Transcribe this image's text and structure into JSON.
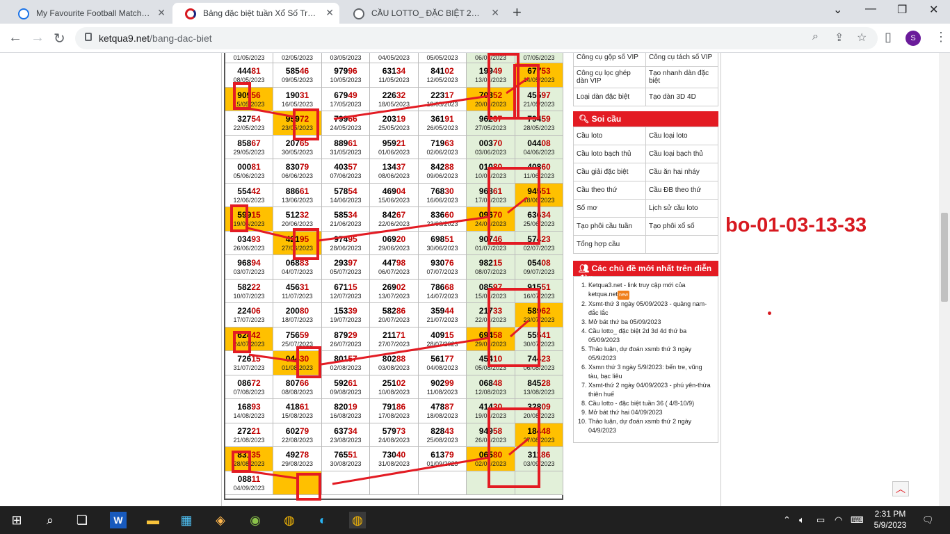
{
  "browser": {
    "tabs": [
      {
        "label": "My Favourite Football Matches, T",
        "active": false
      },
      {
        "label": "Bảng đặc biệt tuần Xổ Số Truyền",
        "active": true
      },
      {
        "label": "CẦU LOTTO_ ĐẶC BIỆT 2D 3D 4D",
        "active": false
      }
    ],
    "url_host": "ketqua9.net",
    "url_path": "/bang-dac-biet",
    "profile_initial": "S"
  },
  "table": {
    "header_dates": [
      "01/05/2023",
      "02/05/2023",
      "03/05/2023",
      "04/05/2023",
      "05/05/2023",
      "06/05/2023",
      "07/05/2023"
    ],
    "rows": [
      [
        {
          "n": "44481",
          "d": "08/05/2023"
        },
        {
          "n": "58546",
          "d": "09/05/2023"
        },
        {
          "n": "97996",
          "d": "10/05/2023"
        },
        {
          "n": "63134",
          "d": "11/05/2023"
        },
        {
          "n": "84102",
          "d": "12/05/2023"
        },
        {
          "n": "19949",
          "d": "13/05/2023"
        },
        {
          "n": "67753",
          "d": "14/05/2023",
          "y": true
        }
      ],
      [
        {
          "n": "90956",
          "d": "15/05/2023",
          "y": true
        },
        {
          "n": "19031",
          "d": "16/05/2023"
        },
        {
          "n": "67949",
          "d": "17/05/2023"
        },
        {
          "n": "22632",
          "d": "18/05/2023"
        },
        {
          "n": "22317",
          "d": "19/05/2023"
        },
        {
          "n": "70852",
          "d": "20/05/2023",
          "y": true
        },
        {
          "n": "45597",
          "d": "21/05/2023"
        }
      ],
      [
        {
          "n": "32754",
          "d": "22/05/2023"
        },
        {
          "n": "95972",
          "d": "23/05/2023",
          "y": true
        },
        {
          "n": "79966",
          "d": "24/05/2023"
        },
        {
          "n": "20319",
          "d": "25/05/2023"
        },
        {
          "n": "36191",
          "d": "26/05/2023"
        },
        {
          "n": "96237",
          "d": "27/05/2023"
        },
        {
          "n": "79459",
          "d": "28/05/2023"
        }
      ],
      [
        {
          "n": "85867",
          "d": "29/05/2023"
        },
        {
          "n": "20765",
          "d": "30/05/2023"
        },
        {
          "n": "88961",
          "d": "31/05/2023"
        },
        {
          "n": "95921",
          "d": "01/06/2023"
        },
        {
          "n": "71963",
          "d": "02/06/2023"
        },
        {
          "n": "00370",
          "d": "03/06/2023"
        },
        {
          "n": "04408",
          "d": "04/06/2023"
        }
      ],
      [
        {
          "n": "00081",
          "d": "05/06/2023"
        },
        {
          "n": "83079",
          "d": "06/06/2023"
        },
        {
          "n": "40357",
          "d": "07/06/2023"
        },
        {
          "n": "13437",
          "d": "08/06/2023"
        },
        {
          "n": "84288",
          "d": "09/06/2023"
        },
        {
          "n": "01080",
          "d": "10/06/2023"
        },
        {
          "n": "40860",
          "d": "11/06/2023"
        }
      ],
      [
        {
          "n": "55442",
          "d": "12/06/2023"
        },
        {
          "n": "88661",
          "d": "13/06/2023"
        },
        {
          "n": "57854",
          "d": "14/06/2023"
        },
        {
          "n": "46904",
          "d": "15/06/2023"
        },
        {
          "n": "76830",
          "d": "16/06/2023"
        },
        {
          "n": "96861",
          "d": "17/06/2023"
        },
        {
          "n": "94551",
          "d": "18/06/2023",
          "y": true
        }
      ],
      [
        {
          "n": "59915",
          "d": "19/06/2023",
          "y": true
        },
        {
          "n": "51232",
          "d": "20/06/2023"
        },
        {
          "n": "58534",
          "d": "21/06/2023"
        },
        {
          "n": "84267",
          "d": "22/06/2023"
        },
        {
          "n": "83660",
          "d": "23/06/2023"
        },
        {
          "n": "09670",
          "d": "24/06/2023",
          "y": true
        },
        {
          "n": "63634",
          "d": "25/06/2023"
        }
      ],
      [
        {
          "n": "03493",
          "d": "26/06/2023"
        },
        {
          "n": "42195",
          "d": "27/06/2023",
          "y": true
        },
        {
          "n": "97495",
          "d": "28/06/2023"
        },
        {
          "n": "06920",
          "d": "29/06/2023"
        },
        {
          "n": "69851",
          "d": "30/06/2023"
        },
        {
          "n": "90746",
          "d": "01/07/2023"
        },
        {
          "n": "57423",
          "d": "02/07/2023"
        }
      ],
      [
        {
          "n": "96894",
          "d": "03/07/2023"
        },
        {
          "n": "06883",
          "d": "04/07/2023"
        },
        {
          "n": "29397",
          "d": "05/07/2023"
        },
        {
          "n": "44798",
          "d": "06/07/2023"
        },
        {
          "n": "93076",
          "d": "07/07/2023"
        },
        {
          "n": "98215",
          "d": "08/07/2023"
        },
        {
          "n": "05408",
          "d": "09/07/2023"
        }
      ],
      [
        {
          "n": "58222",
          "d": "10/07/2023"
        },
        {
          "n": "45631",
          "d": "11/07/2023"
        },
        {
          "n": "67115",
          "d": "12/07/2023"
        },
        {
          "n": "26902",
          "d": "13/07/2023"
        },
        {
          "n": "78668",
          "d": "14/07/2023"
        },
        {
          "n": "08597",
          "d": "15/07/2023"
        },
        {
          "n": "91551",
          "d": "16/07/2023"
        }
      ],
      [
        {
          "n": "22406",
          "d": "17/07/2023"
        },
        {
          "n": "20080",
          "d": "18/07/2023"
        },
        {
          "n": "15339",
          "d": "19/07/2023"
        },
        {
          "n": "58286",
          "d": "20/07/2023"
        },
        {
          "n": "35944",
          "d": "21/07/2023"
        },
        {
          "n": "21733",
          "d": "22/07/2023"
        },
        {
          "n": "58962",
          "d": "23/07/2023",
          "y": true
        }
      ],
      [
        {
          "n": "62442",
          "d": "24/07/2023",
          "y": true
        },
        {
          "n": "75659",
          "d": "25/07/2023"
        },
        {
          "n": "87929",
          "d": "26/07/2023"
        },
        {
          "n": "21171",
          "d": "27/07/2023"
        },
        {
          "n": "40915",
          "d": "28/07/2023"
        },
        {
          "n": "69458",
          "d": "29/07/2023",
          "y": true
        },
        {
          "n": "55541",
          "d": "30/07/2023"
        }
      ],
      [
        {
          "n": "72615",
          "d": "31/07/2023"
        },
        {
          "n": "04430",
          "d": "01/08/2023",
          "y": true
        },
        {
          "n": "80157",
          "d": "02/08/2023"
        },
        {
          "n": "80288",
          "d": "03/08/2023"
        },
        {
          "n": "56177",
          "d": "04/08/2023"
        },
        {
          "n": "45410",
          "d": "05/08/2023"
        },
        {
          "n": "74423",
          "d": "06/08/2023"
        }
      ],
      [
        {
          "n": "08672",
          "d": "07/08/2023"
        },
        {
          "n": "80766",
          "d": "08/08/2023"
        },
        {
          "n": "59261",
          "d": "09/08/2023"
        },
        {
          "n": "25102",
          "d": "10/08/2023"
        },
        {
          "n": "90299",
          "d": "11/08/2023"
        },
        {
          "n": "06848",
          "d": "12/08/2023"
        },
        {
          "n": "84528",
          "d": "13/08/2023"
        }
      ],
      [
        {
          "n": "16893",
          "d": "14/08/2023"
        },
        {
          "n": "41861",
          "d": "15/08/2023"
        },
        {
          "n": "82019",
          "d": "16/08/2023"
        },
        {
          "n": "79186",
          "d": "17/08/2023"
        },
        {
          "n": "47887",
          "d": "18/08/2023"
        },
        {
          "n": "41430",
          "d": "19/08/2023"
        },
        {
          "n": "32809",
          "d": "20/08/2023"
        }
      ],
      [
        {
          "n": "27221",
          "d": "21/08/2023"
        },
        {
          "n": "60279",
          "d": "22/08/2023"
        },
        {
          "n": "63734",
          "d": "23/08/2023"
        },
        {
          "n": "57973",
          "d": "24/08/2023"
        },
        {
          "n": "82843",
          "d": "25/08/2023"
        },
        {
          "n": "94958",
          "d": "26/08/2023"
        },
        {
          "n": "18448",
          "d": "27/08/2023",
          "y": true
        }
      ],
      [
        {
          "n": "83135",
          "d": "28/08/2023",
          "y": true
        },
        {
          "n": "49278",
          "d": "29/08/2023"
        },
        {
          "n": "76551",
          "d": "30/08/2023"
        },
        {
          "n": "73040",
          "d": "31/08/2023"
        },
        {
          "n": "61379",
          "d": "01/09/2023"
        },
        {
          "n": "06580",
          "d": "02/09/2023",
          "y": true
        },
        {
          "n": "31186",
          "d": "03/09/2023"
        }
      ],
      [
        {
          "n": "08811",
          "d": "04/09/2023"
        },
        {
          "n": "",
          "d": "",
          "y": true
        },
        {
          "n": "",
          "d": ""
        },
        {
          "n": "",
          "d": ""
        },
        {
          "n": "",
          "d": ""
        },
        {
          "n": "",
          "d": ""
        },
        {
          "n": "",
          "d": ""
        }
      ]
    ]
  },
  "sidebar": {
    "tools": [
      [
        "Công cụ gộp số VIP",
        "Công cụ tách số VIP"
      ],
      [
        "Công cụ lọc ghép dàn VIP",
        "Tạo nhanh dàn đặc biệt"
      ],
      [
        "Loại dàn đặc biệt",
        "Tạo dàn 3D 4D"
      ]
    ],
    "soi_cau_title": "Soi cầu",
    "soi_cau": [
      [
        "Cầu loto",
        "Cầu loại loto"
      ],
      [
        "Cầu loto bạch thủ",
        "Cầu loại bạch thủ"
      ],
      [
        "Cầu giải đặc biệt",
        "Cầu ăn hai nháy"
      ],
      [
        "Cầu theo thứ",
        "Cầu ĐB theo thứ"
      ],
      [
        "Số mơ",
        "Lịch sử cầu loto"
      ],
      [
        "Tạo phôi cầu tuần",
        "Tạo phôi xổ số"
      ],
      [
        "Tổng hợp cầu",
        ""
      ]
    ],
    "forum_title": "Các chủ đề mới nhất trên diễn đàn",
    "forum_posts": [
      "Ketqua3.net - link truy cập mới của ketqua.net",
      "Xsmt-thứ 3 ngày 05/09/2023 - quảng nam-đắc lắc",
      "Mở bát thứ ba 05/09/2023",
      "Cầu lotto_ đặc biệt 2d 3d 4d thứ ba 05/09/2023",
      "Thảo luận, dự đoán xsmb thứ 3 ngày 05/9/2023",
      "Xsmn thứ 3 ngày 5/9/2023: bến tre, vũng tàu, bạc liêu",
      "Xsmt-thứ 2 ngày 04/09/2023 - phú yên-thừa thiên huế",
      "Cầu lotto - đặc biệt tuần 36 ( 4/8-10/9)",
      "Mở bát thứ hai 04/09/2023",
      "Thảo luận, dự đoán xsmb thứ 2 ngày 04/9/2023"
    ],
    "new_tag": "new"
  },
  "annotation": "bo-01-03-13-33",
  "taskbar": {
    "time": "2:31 PM",
    "date": "5/9/2023"
  },
  "colors": {
    "accent_red": "#d71920",
    "highlight": "#ffc000",
    "green_col": "#e2f0d9"
  }
}
